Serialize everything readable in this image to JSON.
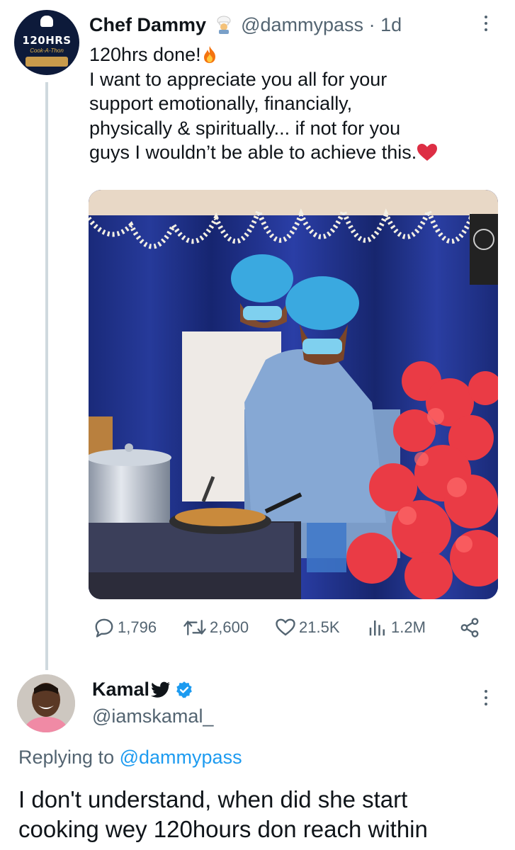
{
  "tweet": {
    "author_name": "Chef Dammy",
    "handle": "@dammypass",
    "separator": "·",
    "time": "1d",
    "avatar_brand": "120HRS",
    "avatar_sub": "Cook-A-Thon",
    "lines": [
      "120hrs done!",
      "I want to appreciate you all for your",
      "support emotionally, financially,",
      "physically & spiritually... if not for you",
      "guys I wouldn’t be able to achieve this."
    ],
    "image_alt": "A woman and man in blue hair nets cooking at a gas stove with a pan, a pot beside them, red flowers in front, and a blue curtain backdrop",
    "stats": {
      "replies": "1,796",
      "retweets": "2,600",
      "likes": "21.5K",
      "views": "1.2M"
    }
  },
  "reply": {
    "author_name": "Kamal",
    "handle": "@iamskamal_",
    "replying_prefix": "Replying to",
    "replying_to": "@dammypass",
    "text_lines": [
      "I don't understand, when did she start",
      "cooking wey 120hours don reach within"
    ]
  },
  "icons": {
    "more": "more-vertical-icon",
    "reply": "reply-icon",
    "retweet": "retweet-icon",
    "like": "heart-icon",
    "views": "views-icon",
    "share": "share-icon",
    "verified": "verified-badge-icon",
    "bird": "twitter-bird-icon"
  },
  "colors": {
    "accent": "#1d9bf0",
    "muted": "#536471",
    "heart": "#e0245e",
    "thread_line": "#cfd9de"
  }
}
